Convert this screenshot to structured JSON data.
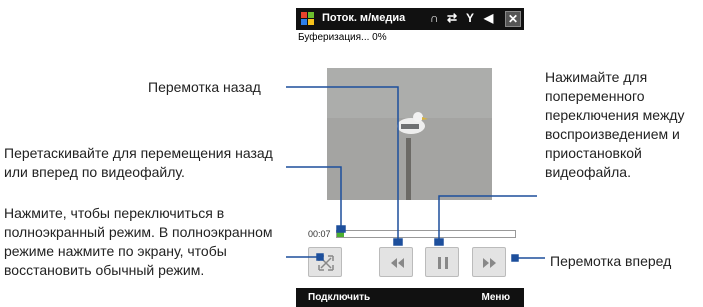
{
  "callouts": {
    "rewind": "Перемотка назад",
    "drag": "Перетаскивайте для перемещения назад или вперед по видеофайлу.",
    "fullscreen": "Нажмите, чтобы переключиться в полноэкранный режим. В полноэкранном режиме нажмите по экрану, чтобы восстановить обычный режим.",
    "toggle": "Нажимайте для попеременного переключения между воспроизведением и приостановкой видеофайла.",
    "fastforward": "Перемотка вперед"
  },
  "phone": {
    "title": "Поток. м/медиа",
    "status_icons": [
      "headset-icon",
      "sync-icon",
      "signal-icon",
      "volume-icon",
      "close-icon"
    ],
    "buffering": "Буферизация... 0%",
    "time": "00:07",
    "progress": 0.04,
    "buttons": [
      "fullscreen-icon",
      "rewind-icon",
      "pause-icon",
      "fast-forward-icon"
    ],
    "softkey_left": "Подключить",
    "softkey_right": "Меню"
  },
  "colors": {
    "accent": "#1d4f9c",
    "progress": "#4caf30"
  }
}
